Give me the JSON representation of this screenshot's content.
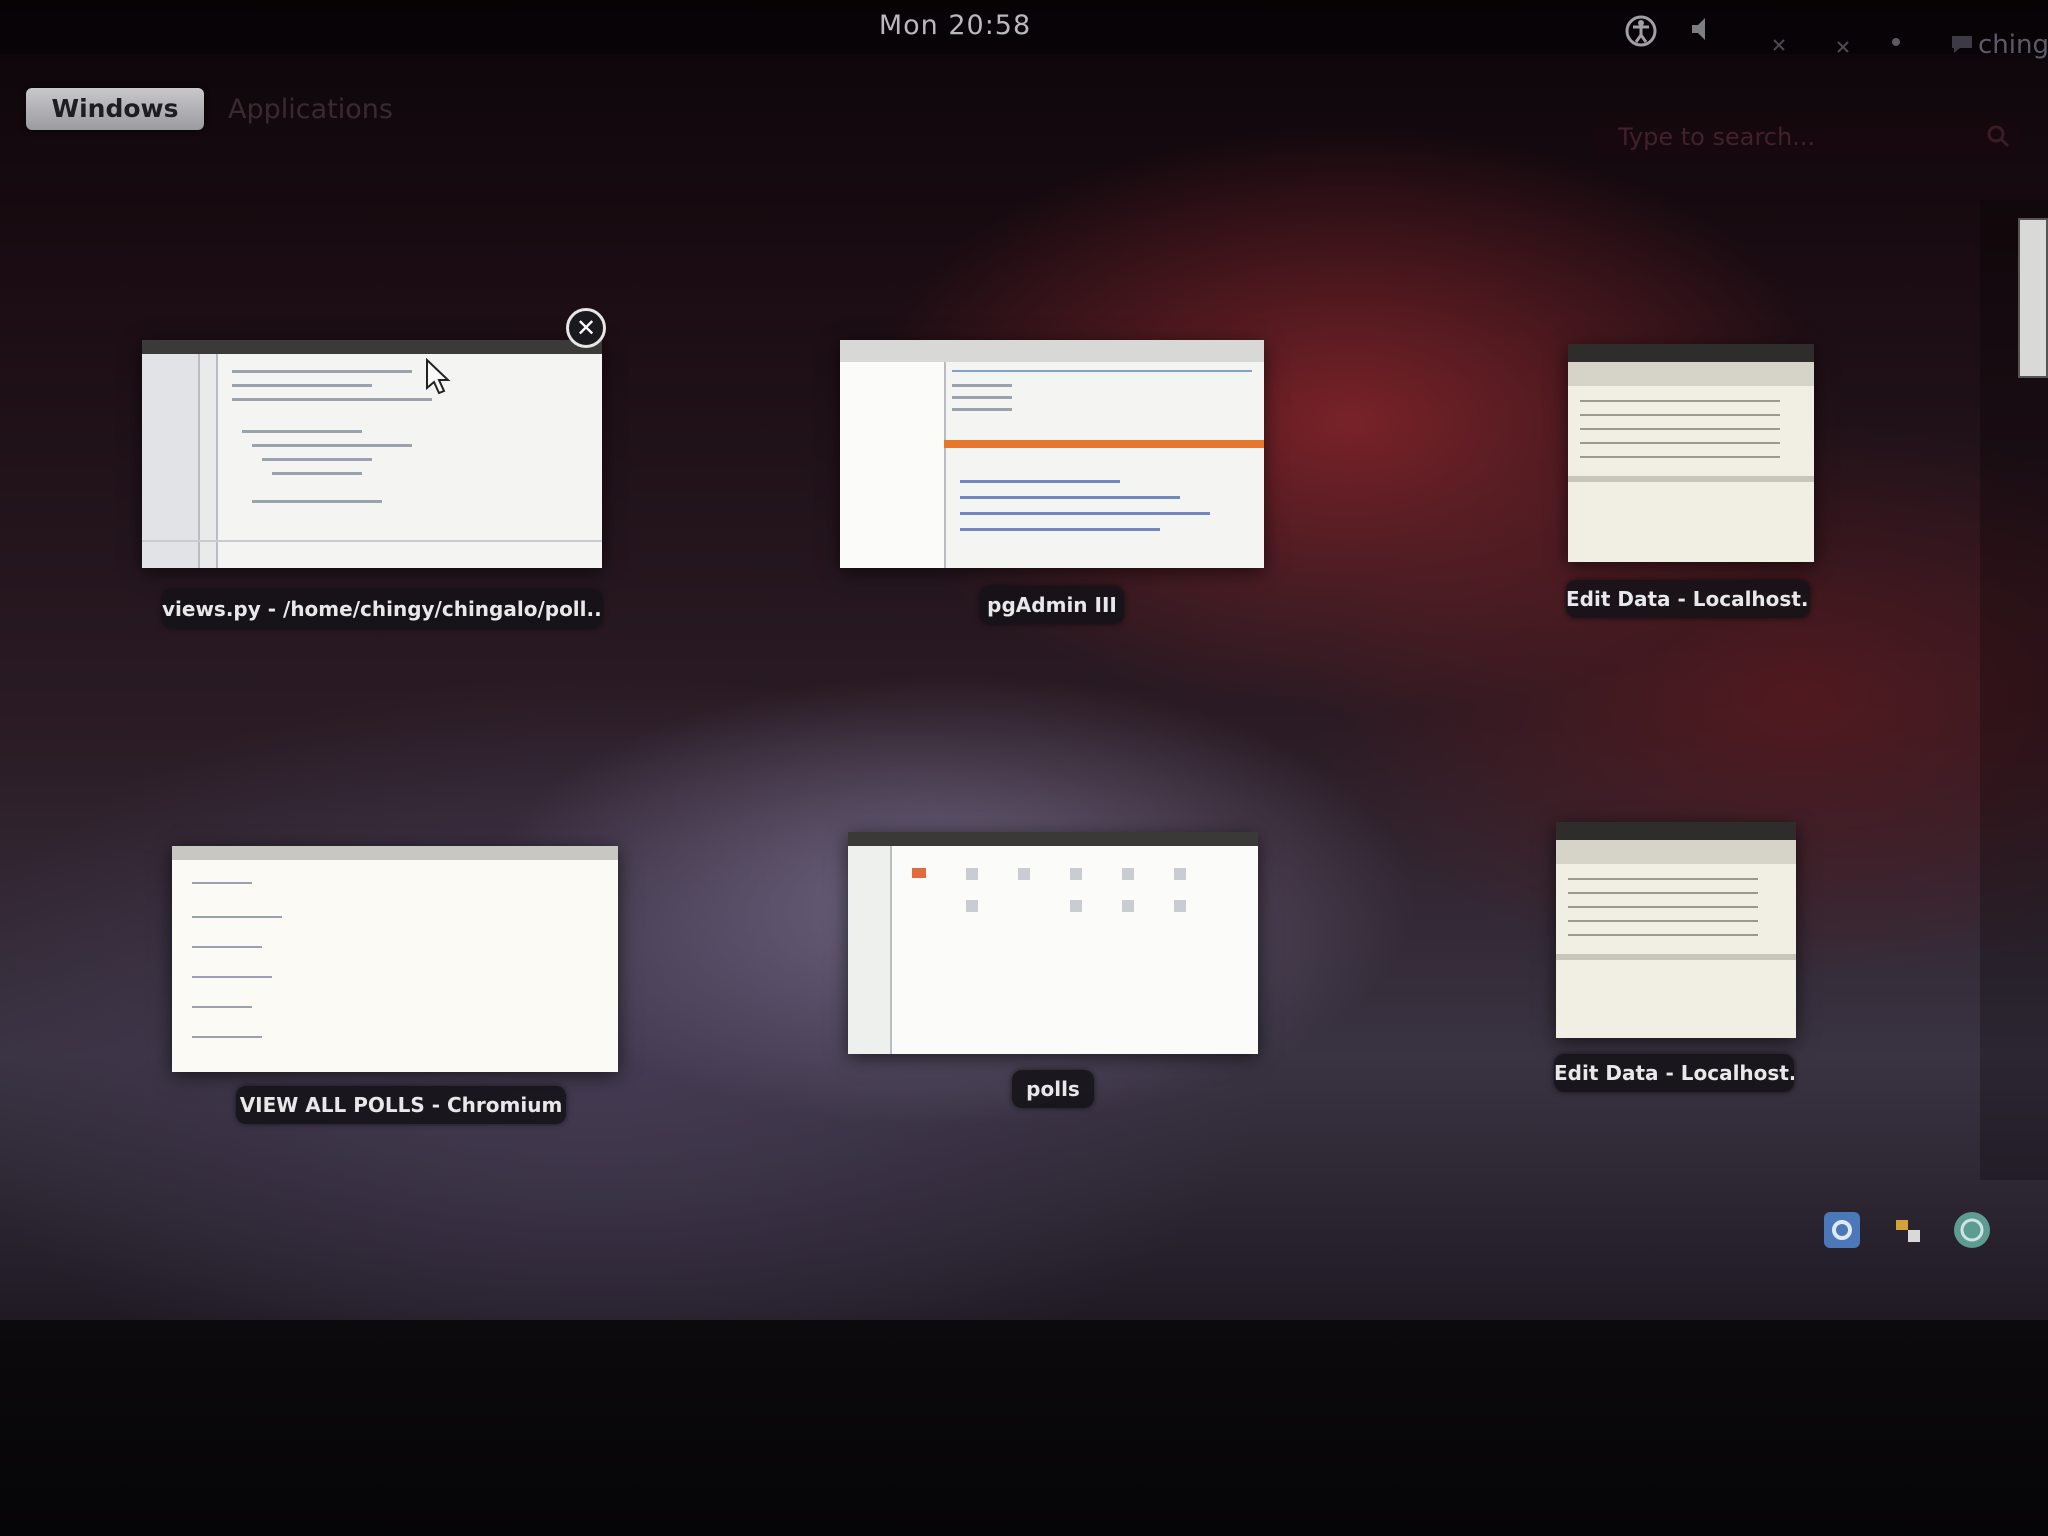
{
  "top_bar": {
    "clock": "Mon 20:58",
    "user": "ching",
    "icons": [
      "accessibility-icon",
      "volume-icon",
      "network-icon",
      "bluetooth-icon",
      "battery-icon",
      "chat-icon"
    ]
  },
  "view_selector": {
    "tabs": [
      "Windows",
      "Applications"
    ],
    "active": "Windows"
  },
  "search": {
    "placeholder": "Type to search..."
  },
  "windows": [
    {
      "title": "views.py - /home/chingy/chingalo/poll...",
      "app": "text-editor",
      "has_close_button": true
    },
    {
      "title": "pgAdmin III",
      "app": "pgadmin"
    },
    {
      "title": "Edit Data - Localhost...",
      "app": "pgadmin-edit-data"
    },
    {
      "title": "VIEW ALL POLLS - Chromium",
      "app": "chromium"
    },
    {
      "title": "polls",
      "app": "file-manager"
    },
    {
      "title": "Edit Data - Localhost...",
      "app": "pgadmin-edit-data"
    }
  ],
  "message_tray": {
    "icons": [
      "settings-notification-icon",
      "network-notification-icon",
      "update-notification-icon"
    ]
  },
  "colors": {
    "caption_bg": "#141218",
    "caption_text": "#e8e8ea",
    "active_tab_bg": "#b8b8bc",
    "pgadmin_accent": "#e8772e"
  }
}
